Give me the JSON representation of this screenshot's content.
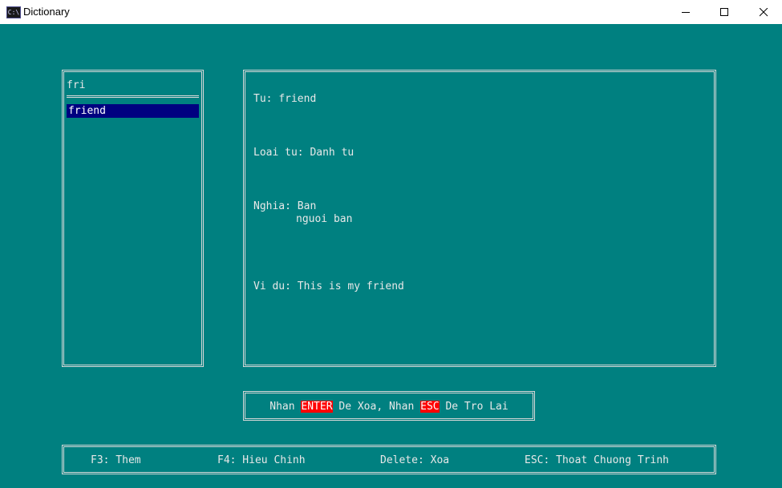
{
  "window": {
    "title": "Dictionary",
    "icon": "C:\\"
  },
  "search": {
    "query": "fri",
    "results": [
      "friend"
    ]
  },
  "detail": {
    "word_label": "Tu:",
    "word": "friend",
    "type_label": "Loai tu:",
    "type": "Danh tu",
    "meaning_label": "Nghia:",
    "meanings": [
      "Ban",
      "nguoi ban"
    ],
    "example_label": "Vi du:",
    "example": "This is my friend"
  },
  "confirm": {
    "prefix": "Nhan",
    "key1": "ENTER",
    "middle": "De Xoa, Nhan",
    "key2": "ESC",
    "suffix": "De Tro Lai",
    "key_color": "#ff0000"
  },
  "footer": {
    "items": [
      "F3: Them",
      "F4: Hieu Chinh",
      "Delete: Xoa",
      "ESC: Thoat Chuong Trinh"
    ]
  },
  "colors": {
    "background": "#008080",
    "selection": "#000080",
    "text": "#e8e8e8"
  },
  "icons": {
    "app": "console-app-icon",
    "min": "minimize-icon",
    "max": "maximize-icon",
    "close": "close-icon"
  }
}
